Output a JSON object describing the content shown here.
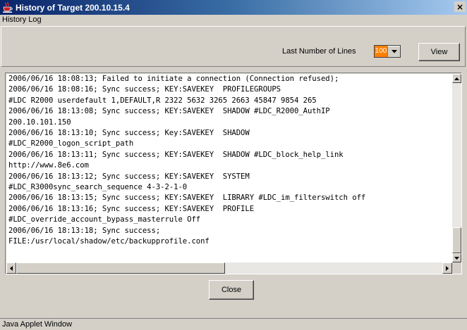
{
  "window": {
    "title": "History of Target 200.10.15.4",
    "close_glyph": "×",
    "icon": "java-cup-icon"
  },
  "section_label": "History Log",
  "toolbar": {
    "lines_label": "Last Number of Lines",
    "lines_value": "100",
    "view_label": "View"
  },
  "log": {
    "lines": [
      "2006/06/16 18:08:13; Failed to initiate a connection (Connection refused);",
      "2006/06/16 18:08:16; Sync success; KEY:SAVEKEY  PROFILEGROUPS",
      "#LDC R2000 userdefault 1,DEFAULT,R 2322 5632 3265 2663 45847 9854 265",
      "2006/06/16 18:13:08; Sync success; KEY:SAVEKEY  SHADOW #LDC_R2000_AuthIP",
      "200.10.101.150",
      "2006/06/16 18:13:10; Sync success; Key:SAVEKEY  SHADOW",
      "#LDC_R2000_logon_script_path",
      "2006/06/16 18:13:11; Sync success; KEY:SAVEKEY  SHADOW #LDC_block_help_link",
      "http://www.8e6.com",
      "2006/06/16 18:13:12; Sync success; KEY:SAVEKEY  SYSTEM",
      "#LDC_R3000sync_search_sequence 4-3-2-1-0",
      "2006/06/16 18:13:15; Sync success; KEY:SAVEKEY  LIBRARY #LDC_im_filterswitch off",
      "2006/06/16 18:13:16; Sync success; KEY:SAVEKEY  PROFILE",
      "#LDC_override_account_bypass_masterrule Off",
      "2006/06/16 18:13:18; Sync success;",
      "FILE:/usr/local/shadow/etc/backupprofile.conf"
    ]
  },
  "close_label": "Close",
  "status": "Java Applet Window",
  "colors": {
    "lines_value_bg": "#ff7f00",
    "title_gradient_start": "#0a246a",
    "title_gradient_end": "#a6caf0"
  }
}
